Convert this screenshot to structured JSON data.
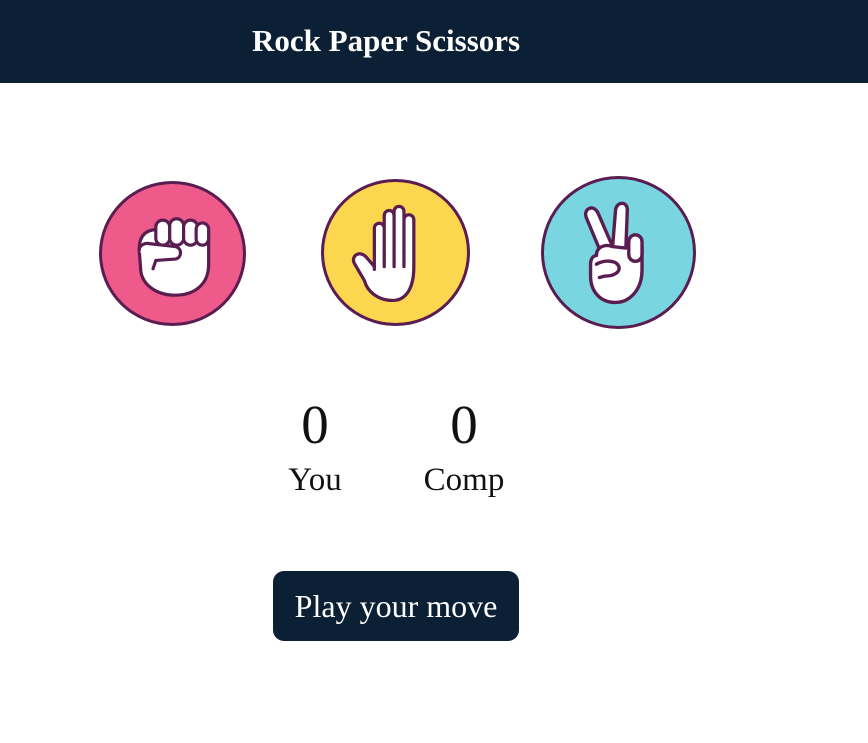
{
  "header": {
    "title": "Rock Paper Scissors"
  },
  "choices": [
    {
      "name": "rock",
      "icon": "rock-hand-icon",
      "color": "#ee5b8a"
    },
    {
      "name": "paper",
      "icon": "paper-hand-icon",
      "color": "#fdd64f"
    },
    {
      "name": "scissors",
      "icon": "scissors-hand-icon",
      "color": "#79d6e0"
    }
  ],
  "scoreboard": {
    "you": {
      "value": "0",
      "label": "You"
    },
    "comp": {
      "value": "0",
      "label": "Comp"
    }
  },
  "actions": {
    "play_label": "Play your move"
  },
  "colors": {
    "header_bg": "#0b1f35",
    "button_bg": "#0b1f35",
    "circle_border": "#5a1d52",
    "hand_outline": "#5a1d52"
  }
}
